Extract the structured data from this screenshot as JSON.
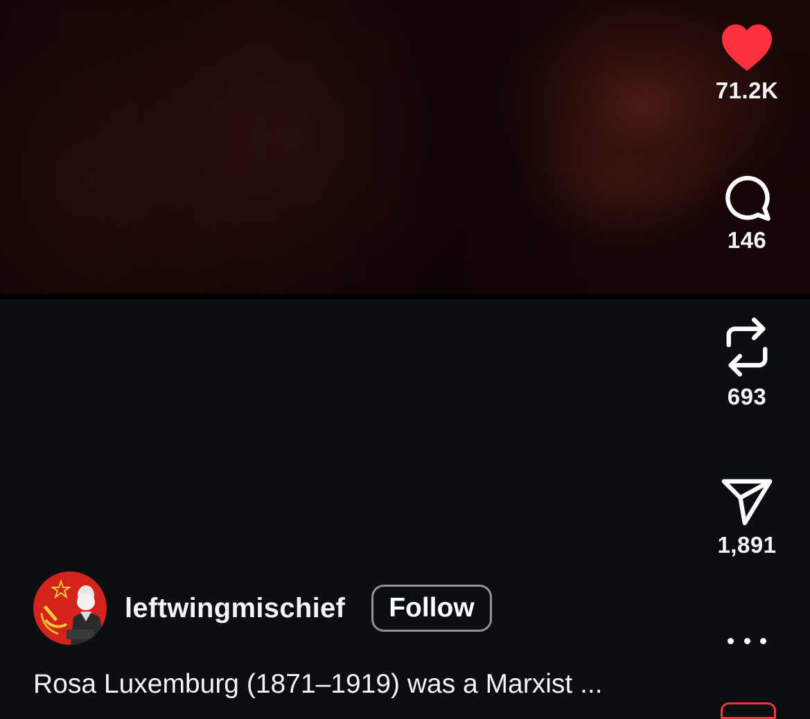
{
  "actions": {
    "like": {
      "icon": "heart-icon",
      "count": "71.2K",
      "color": "#ff3040"
    },
    "comment": {
      "icon": "comment-icon",
      "count": "146"
    },
    "repost": {
      "icon": "repost-icon",
      "count": "693"
    },
    "share": {
      "icon": "send-icon",
      "count": "1,891"
    },
    "more": {
      "icon": "more-dots-icon"
    }
  },
  "post": {
    "username": "leftwingmischief",
    "follow_label": "Follow",
    "caption": "Rosa Luxemburg (1871–1919) was a Marxist ..."
  }
}
